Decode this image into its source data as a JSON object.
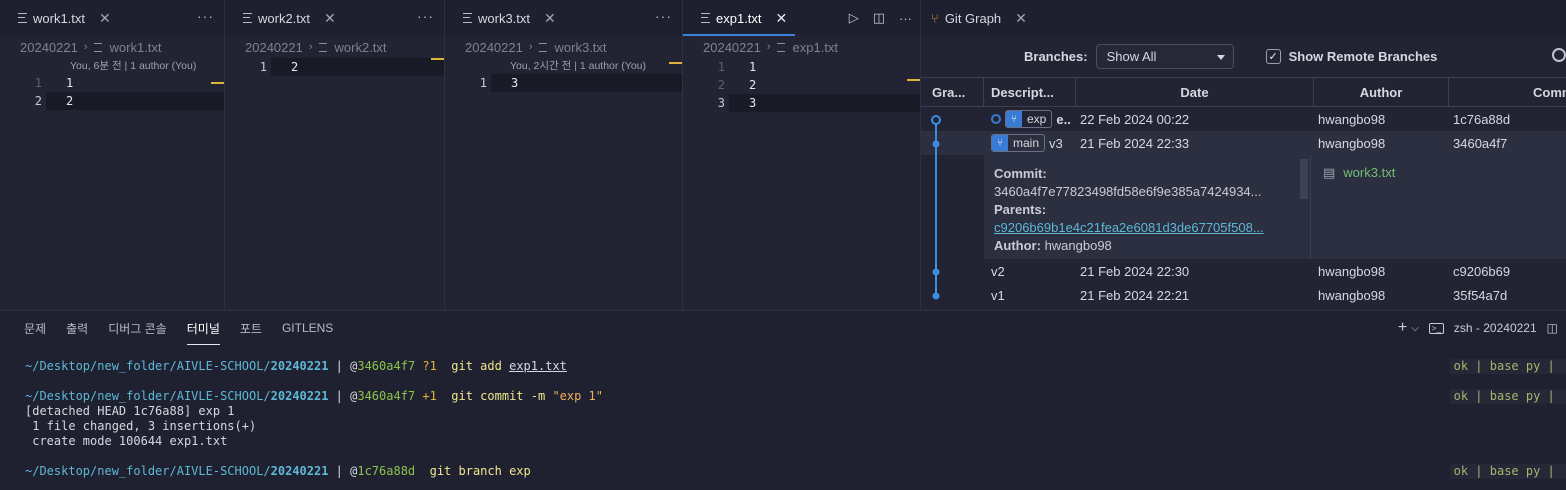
{
  "editors": [
    {
      "tab": "work1.txt",
      "crumb_folder": "20240221",
      "crumb_file": "work1.txt",
      "blame": "You, 6분 전 | 1 author (You)",
      "lines": [
        "1",
        "2"
      ]
    },
    {
      "tab": "work2.txt",
      "crumb_folder": "20240221",
      "crumb_file": "work2.txt",
      "blame": "",
      "lines": [
        "2"
      ]
    },
    {
      "tab": "work3.txt",
      "crumb_folder": "20240221",
      "crumb_file": "work3.txt",
      "blame": "You, 2시간 전 | 1 author (You)",
      "lines": [
        "3"
      ]
    },
    {
      "tab": "exp1.txt",
      "crumb_folder": "20240221",
      "crumb_file": "exp1.txt",
      "blame": "",
      "lines": [
        "1",
        "2",
        "3"
      ]
    }
  ],
  "gitgraph": {
    "tab": "Git Graph",
    "branches_label": "Branches:",
    "branches_value": "Show All",
    "remote_label": "Show Remote Branches",
    "headers": [
      "Gra...",
      "Descript...",
      "Date",
      "Author",
      "Comm"
    ],
    "rows": [
      {
        "ref": "exp",
        "desc": "e..",
        "date": "22 Feb 2024 00:22",
        "author": "hwangbo98",
        "commit": "1c76a88d"
      },
      {
        "ref": "main",
        "desc": "v3",
        "date": "21 Feb 2024 22:33",
        "author": "hwangbo98",
        "commit": "3460a4f7"
      },
      {
        "ref": "",
        "desc": "v2",
        "date": "21 Feb 2024 22:30",
        "author": "hwangbo98",
        "commit": "c9206b69"
      },
      {
        "ref": "",
        "desc": "v1",
        "date": "21 Feb 2024 22:21",
        "author": "hwangbo98",
        "commit": "35f54a7d"
      }
    ],
    "detail": {
      "commit_label": "Commit:",
      "commit": "3460a4f7e77823498fd58e6f9e385a7424934...",
      "parents_label": "Parents:",
      "parents": "c9206b69b1e4c21fea2e6081d3de67705f508...",
      "author_label": "Author:",
      "author": "hwangbo98",
      "file": "work3.txt"
    }
  },
  "panel": {
    "tabs": [
      "문제",
      "출력",
      "디버그 콘솔",
      "터미널",
      "포트",
      "GITLENS"
    ],
    "shell": "zsh - 20240221",
    "terminal": {
      "path": "~/Desktop/new_folder/AIVLE-SCHOOL/",
      "dir": "20240221",
      "prompt1_hash": "3460a4f7",
      "prompt1_flag": "?1",
      "cmd1": "git add",
      "cmd1_arg": "exp1.txt",
      "prompt2_hash": "3460a4f7",
      "prompt2_flag": "+1",
      "cmd2": "git commit -m",
      "cmd2_arg": "\"exp 1\"",
      "out1": "[detached HEAD 1c76a88] exp 1",
      "out2": " 1 file changed, 3 insertions(+)",
      "out3": " create mode 100644 exp1.txt",
      "prompt3_hash": "1c76a88d",
      "cmd3": "git branch exp",
      "status": "ok | base py | "
    }
  }
}
